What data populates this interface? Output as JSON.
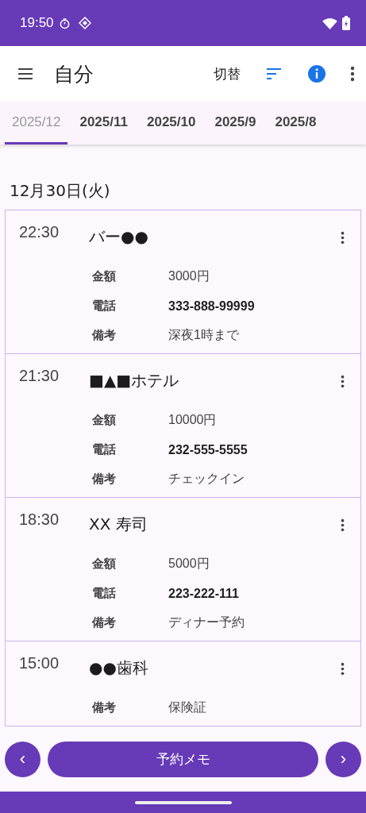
{
  "status_bar": {
    "time": "19:50"
  },
  "app_bar": {
    "title": "自分",
    "switch_label": "切替"
  },
  "tabs": [
    {
      "label": "2025/12",
      "selected": true
    },
    {
      "label": "2025/11",
      "selected": false
    },
    {
      "label": "2025/10",
      "selected": false
    },
    {
      "label": "2025/9",
      "selected": false
    },
    {
      "label": "2025/8",
      "selected": false
    }
  ],
  "date_header": "12月30日(火)",
  "entries": [
    {
      "time": "22:30",
      "title": "バー●●",
      "details": [
        {
          "kind": "amount",
          "label": "金額",
          "value": "3000円"
        },
        {
          "kind": "phone",
          "label": "電話",
          "value": "333-888-99999"
        },
        {
          "kind": "note",
          "label": "備考",
          "value": "深夜1時まで"
        }
      ]
    },
    {
      "time": "21:30",
      "title": "■▲■ホテル",
      "details": [
        {
          "kind": "amount",
          "label": "金額",
          "value": "10000円"
        },
        {
          "kind": "phone",
          "label": "電話",
          "value": "232-555-5555"
        },
        {
          "kind": "note",
          "label": "備考",
          "value": "チェックイン"
        }
      ]
    },
    {
      "time": "18:30",
      "title": "XX 寿司",
      "details": [
        {
          "kind": "amount",
          "label": "金額",
          "value": "5000円"
        },
        {
          "kind": "phone",
          "label": "電話",
          "value": "223-222-111"
        },
        {
          "kind": "note",
          "label": "備考",
          "value": "ディナー予約"
        }
      ]
    },
    {
      "time": "15:00",
      "title": "●●歯科",
      "details": [
        {
          "kind": "note",
          "label": "備考",
          "value": "保険証"
        }
      ]
    }
  ],
  "footer": {
    "prev": "‹",
    "main": "予約メモ",
    "next": "›"
  }
}
